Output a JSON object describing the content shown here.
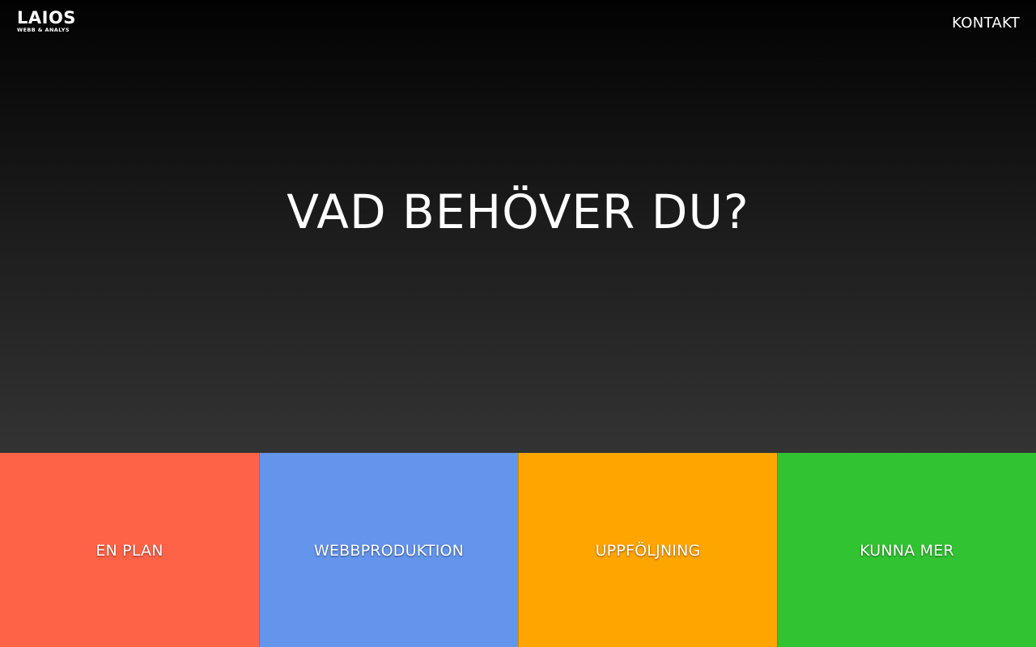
{
  "header": {
    "logo": {
      "name": "LAIOS",
      "subtitle": "WEBB & ANALYS"
    },
    "nav": {
      "contact_label": "KONTAKT"
    }
  },
  "hero": {
    "headline": "VAD BEHÖVER DU?"
  },
  "tiles": [
    {
      "label": "EN PLAN",
      "color": "#ff6347"
    },
    {
      "label": "WEBBPRODUKTION",
      "color": "#6495ed"
    },
    {
      "label": "UPPFÖLJNING",
      "color": "#ffa500"
    },
    {
      "label": "KUNNA MER",
      "color": "#32c332"
    }
  ],
  "colors": {
    "hero_gradient_top": "#020202",
    "hero_gradient_bottom": "#333333",
    "text": "#ffffff"
  }
}
